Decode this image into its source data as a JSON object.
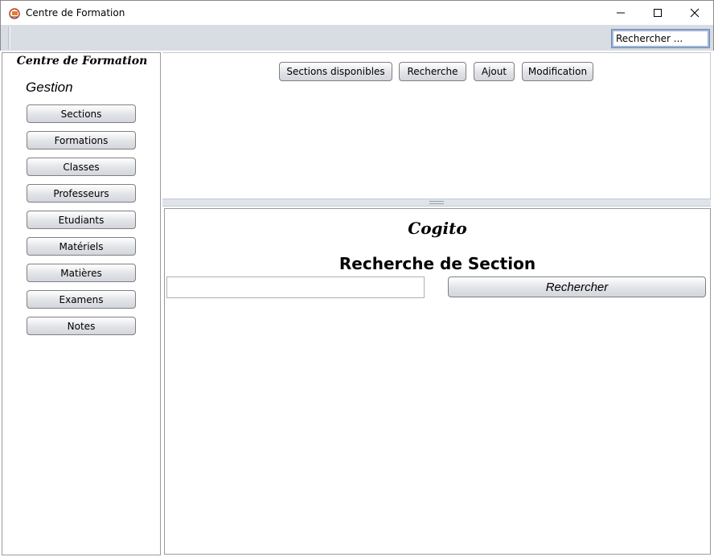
{
  "window": {
    "title": "Centre de Formation",
    "icon": "app-logo-icon",
    "controls": [
      "minimize-icon",
      "maximize-icon",
      "close-icon"
    ]
  },
  "toolbar": {
    "search_value": "Rechercher ..."
  },
  "sidebar": {
    "brand": "Centre de Formation",
    "heading": "Gestion",
    "items": [
      {
        "label": "Sections"
      },
      {
        "label": "Formations"
      },
      {
        "label": "Classes"
      },
      {
        "label": "Professeurs"
      },
      {
        "label": "Etudiants"
      },
      {
        "label": "Matériels"
      },
      {
        "label": "Matières"
      },
      {
        "label": "Examens"
      },
      {
        "label": "Notes"
      }
    ]
  },
  "main": {
    "tabs": [
      {
        "label": "Sections disponibles"
      },
      {
        "label": "Recherche"
      },
      {
        "label": "Ajout"
      },
      {
        "label": "Modification"
      }
    ],
    "content": {
      "brand": "Cogito",
      "title": "Recherche de Section",
      "search_value": "",
      "search_button": "Rechercher"
    }
  }
}
